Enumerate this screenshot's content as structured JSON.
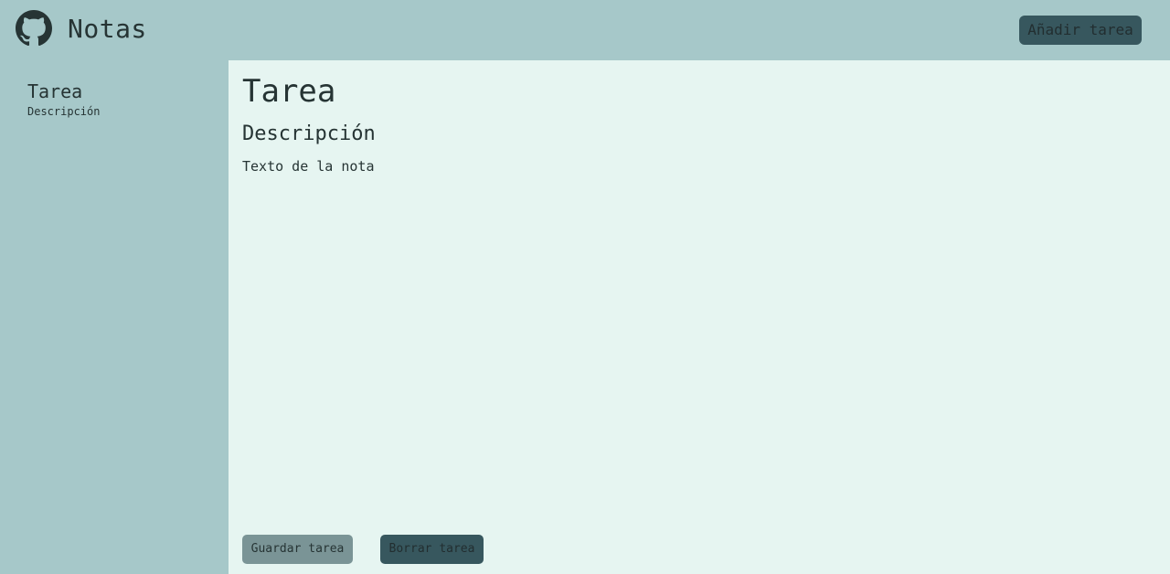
{
  "header": {
    "logo_icon": "github-icon",
    "title": "Notas",
    "add_button_label": "Añadir tarea"
  },
  "sidebar": {
    "items": [
      {
        "title": "Tarea",
        "description": "Descripción"
      }
    ]
  },
  "main": {
    "title": "Tarea",
    "description": "Descripción",
    "body": "Texto de la nota",
    "save_label": "Guardar tarea",
    "delete_label": "Borrar tarea"
  },
  "colors": {
    "header_bg": "#a6c8c9",
    "main_bg": "#e6f5f1",
    "accent_dark": "#37575e",
    "button_muted": "#7a9496",
    "text": "#263434"
  }
}
